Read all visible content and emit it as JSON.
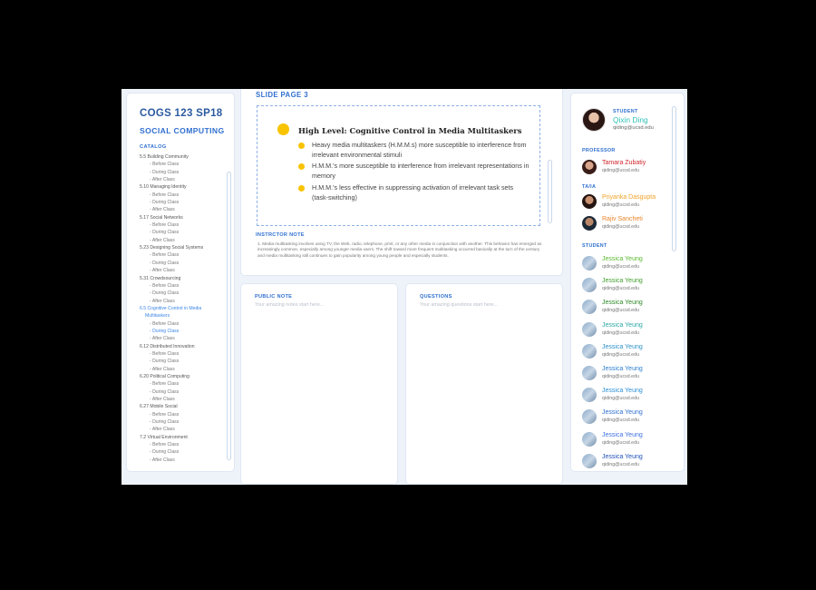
{
  "course": {
    "code": "COGS 123 SP18",
    "name": "SOCIAL COMPUTING"
  },
  "catalog": {
    "label": "CATALOG",
    "items": [
      {
        "label": "5.5 Building Community",
        "kind": "topic"
      },
      {
        "label": "- Before Class",
        "kind": "sub"
      },
      {
        "label": "- During Class",
        "kind": "sub"
      },
      {
        "label": "- After Class",
        "kind": "sub"
      },
      {
        "label": "5.10 Managing Identity",
        "kind": "topic"
      },
      {
        "label": "- Before Class",
        "kind": "sub"
      },
      {
        "label": "- During Class",
        "kind": "sub"
      },
      {
        "label": "- After Class",
        "kind": "sub"
      },
      {
        "label": "5.17 Social Networks",
        "kind": "topic"
      },
      {
        "label": "- Before Class",
        "kind": "sub"
      },
      {
        "label": "- During Class",
        "kind": "sub"
      },
      {
        "label": "- After Class",
        "kind": "sub"
      },
      {
        "label": "5.23 Designing Social Systems",
        "kind": "topic"
      },
      {
        "label": "- Before Class",
        "kind": "sub"
      },
      {
        "label": "- During Class",
        "kind": "sub"
      },
      {
        "label": "- After Class",
        "kind": "sub"
      },
      {
        "label": "5.31 Crowdsourcing",
        "kind": "topic"
      },
      {
        "label": "- Before Class",
        "kind": "sub"
      },
      {
        "label": "- During Class",
        "kind": "sub"
      },
      {
        "label": "- After Class",
        "kind": "sub"
      },
      {
        "label": "6.5 Cognitive Control in Media",
        "kind": "topic-active"
      },
      {
        "label": "Multitaskers",
        "kind": "wrap-active"
      },
      {
        "label": "- Before Class",
        "kind": "sub"
      },
      {
        "label": "- During Class",
        "kind": "sub-active"
      },
      {
        "label": "- After Class",
        "kind": "sub"
      },
      {
        "label": "6.12 Distributed Innovation",
        "kind": "topic"
      },
      {
        "label": "- Before Class",
        "kind": "sub"
      },
      {
        "label": "- During Class",
        "kind": "sub"
      },
      {
        "label": "- After Class",
        "kind": "sub"
      },
      {
        "label": "6.20 Political Computing",
        "kind": "topic"
      },
      {
        "label": "- Before Class",
        "kind": "sub"
      },
      {
        "label": "- During Class",
        "kind": "sub"
      },
      {
        "label": "- After Class",
        "kind": "sub"
      },
      {
        "label": "6.27 Mobile Social",
        "kind": "topic"
      },
      {
        "label": "- Before Class",
        "kind": "sub"
      },
      {
        "label": "- During Class",
        "kind": "sub"
      },
      {
        "label": "- After Class",
        "kind": "sub"
      },
      {
        "label": "7.2 Virtual Environment",
        "kind": "topic"
      },
      {
        "label": "- Before Class",
        "kind": "sub"
      },
      {
        "label": "- During Class",
        "kind": "sub"
      },
      {
        "label": "- After Class",
        "kind": "sub"
      }
    ]
  },
  "slide": {
    "label": "SLIDE PAGE 3",
    "heading": "High Level: Cognitive Control in Media Multitaskers",
    "bullets": [
      "Heavy media multitaskers (H.M.M.s) more susceptible to interference from irrelevant environmental stimuli",
      "H.M.M.'s more susceptible to interference from irrelevant representations in memory",
      "H.M.M.'s less effective in suppressing activation of irrelevant task sets (task-switching)"
    ],
    "instructor_note_label": "INSTRCTOR NOTE",
    "instructor_note": "1. Media multitasking involves using TV, the Web, radio, telephone, print, or any other media in conjunction with another. This behavior has emerged as increasingly common, especially among younger media users. The shift toward more frequent multitasking occurred basically at the turn of the century and media multitasking still continues to gain popularity among young people and especially students."
  },
  "public_note": {
    "label": "PUBLIC NOTE",
    "placeholder": "Your amazing notes start here..."
  },
  "questions": {
    "label": "QUESTIONS",
    "placeholder": "Your amazing questions start here..."
  },
  "me": {
    "role": "STUDENT",
    "name": "Qixin Ding",
    "email": "qiding@ucsd.edu"
  },
  "sections": {
    "professor": "PROFESSOR",
    "ta": "TA/IA",
    "student": "STUDENT"
  },
  "professors": [
    {
      "name": "Tamara Zubatiy",
      "email": "qiding@ucsd.edu",
      "color": "#d0262c"
    }
  ],
  "tas": [
    {
      "name": "Priyanka Dasgupta",
      "email": "qiding@ucsd.edu",
      "color": "#f1a32a"
    },
    {
      "name": "Rajiv Sancheti",
      "email": "qiding@ucsd.edu",
      "color": "#e8862a"
    }
  ],
  "students": [
    {
      "name": "Jessica Yeung",
      "email": "qiding@ucsd.edu",
      "color": "#5cb82e"
    },
    {
      "name": "Jessica Yeung",
      "email": "qiding@ucsd.edu",
      "color": "#3f9e2a"
    },
    {
      "name": "Jessica Yeung",
      "email": "qiding@ucsd.edu",
      "color": "#2c8a25"
    },
    {
      "name": "Jessica Yeung",
      "email": "qiding@ucsd.edu",
      "color": "#2aa6a3"
    },
    {
      "name": "Jessica Yeung",
      "email": "qiding@ucsd.edu",
      "color": "#2b90c8"
    },
    {
      "name": "Jessica Yeung",
      "email": "qiding@ucsd.edu",
      "color": "#2b7fd0"
    },
    {
      "name": "Jessica Yeung",
      "email": "qiding@ucsd.edu",
      "color": "#2b8fd6"
    },
    {
      "name": "Jessica Yeung",
      "email": "qiding@ucsd.edu",
      "color": "#2f6fd0"
    },
    {
      "name": "Jessica Yeung",
      "email": "qiding@ucsd.edu",
      "color": "#3d6fe0"
    },
    {
      "name": "Jessica Yeung",
      "email": "qiding@ucsd.edu",
      "color": "#1f4fb8"
    }
  ]
}
